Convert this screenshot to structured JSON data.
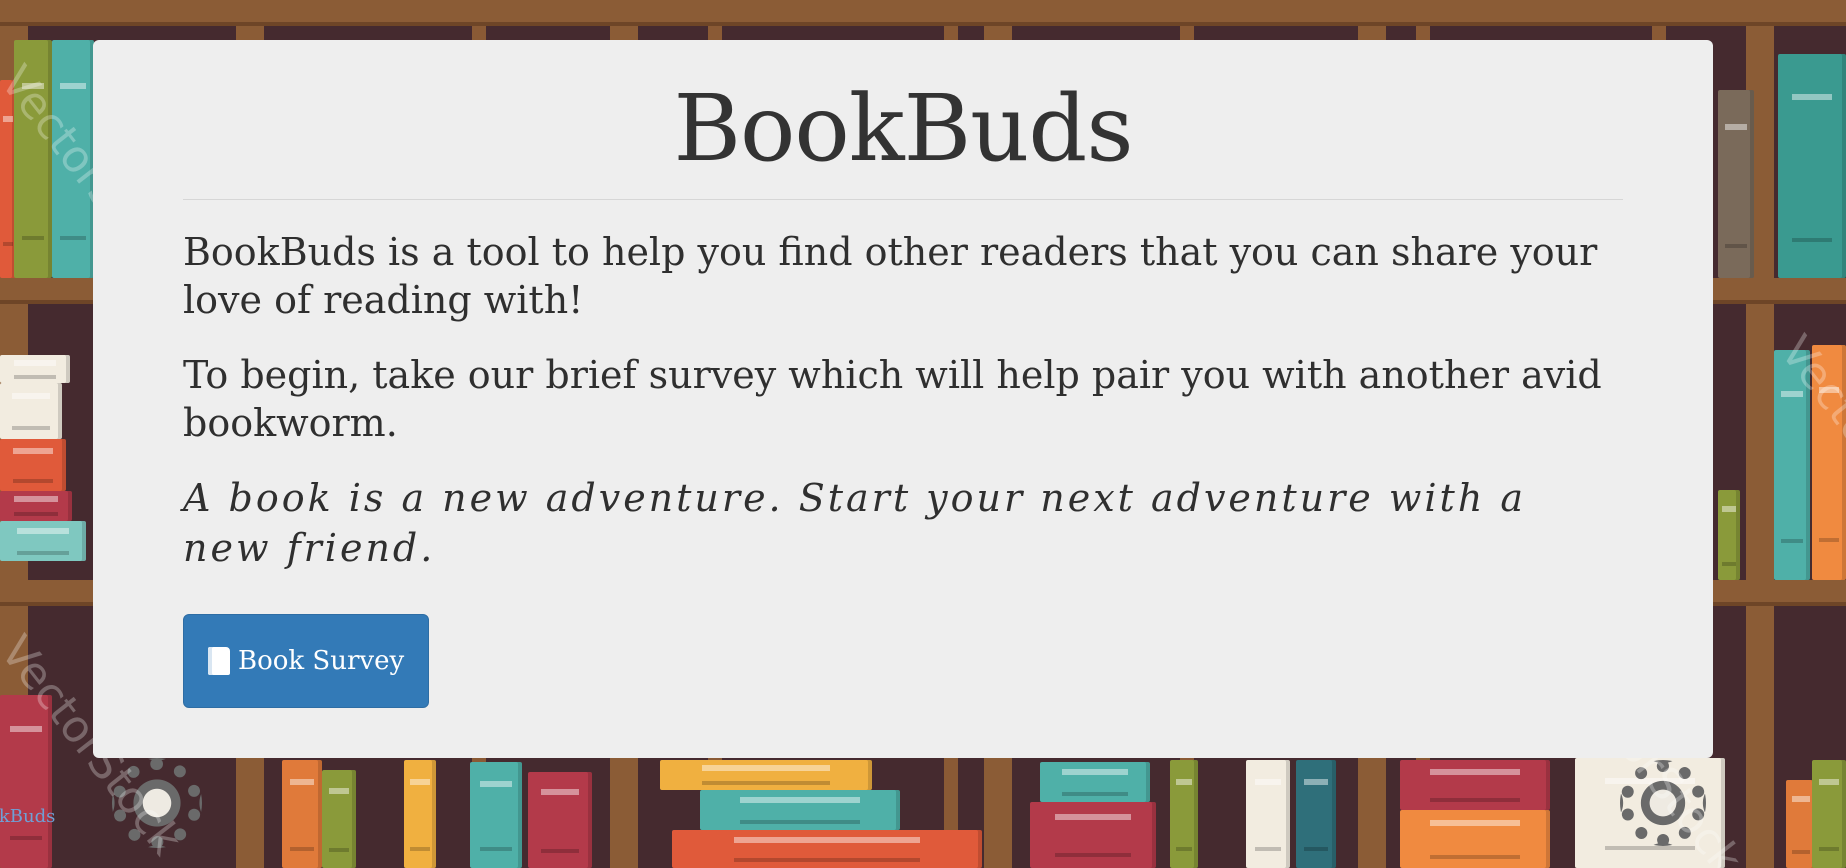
{
  "page": {
    "title": "BookBuds",
    "paragraphs": [
      "BookBuds is a tool to help you find other readers that you can share your love of reading with!",
      "To begin, take our brief survey which will help pair you with another avid bookworm."
    ],
    "quote": "A book is a new adventure. Start your next adventure with a new friend.",
    "survey_button": {
      "label": "Book Survey",
      "icon": "book-icon"
    }
  },
  "footer": {
    "link_text": "BookBuds"
  },
  "background": {
    "watermark": "VectorStock"
  },
  "colors": {
    "card": "#eeeeee",
    "button": "#337ab7",
    "text": "#333333",
    "shelf_wood": "#8b5c36",
    "shelf_back": "#452a2f"
  }
}
